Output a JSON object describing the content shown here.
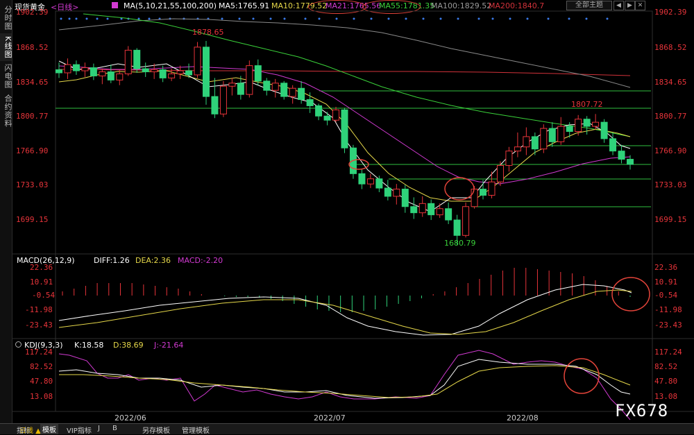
{
  "left_tabs": [
    {
      "label": "分时图",
      "active": false
    },
    {
      "label": "K线图",
      "active": true
    },
    {
      "label": "闪电图",
      "active": false
    },
    {
      "label": "合约资料",
      "active": false
    }
  ],
  "header": {
    "symbol": "现货黄金",
    "period": "<日线>",
    "ma_params": "MA(5,10,21,55,100,200)",
    "ma5": "MA5:1765.91",
    "ma10": "MA10:1779.52",
    "ma21": "MA21:1765.56",
    "ma55": "MA55:1781.35",
    "ma100": "MA100:1829.52",
    "ma200": "MA200:1840.7",
    "theme_select": "全部主题",
    "colors": {
      "ma5": "#ffffff",
      "ma10": "#e6d84a",
      "ma21": "#d23ad2",
      "ma55": "#3ad23a",
      "ma100": "#9a9a9a",
      "ma200": "#d2323a"
    }
  },
  "price_axis": {
    "ticks": [
      "1902.39",
      "1868.52",
      "1834.65",
      "1800.77",
      "1766.90",
      "1733.03",
      "1699.15"
    ]
  },
  "annotations": {
    "high1": "1878.65",
    "high2": "1807.72",
    "low": "1680.79"
  },
  "macd": {
    "title": "MACD(26,12,9)",
    "diff": "DIFF:1.26",
    "dea": "DEA:2.36",
    "macd": "MACD:-2.20",
    "ticks": [
      "22.36",
      "10.91",
      "-0.54",
      "-11.98",
      "-23.43"
    ]
  },
  "kdj": {
    "title": "KDJ(9,3,3)",
    "k": "K:18.58",
    "d": "D:38.69",
    "j": "J:-21.64",
    "ticks": [
      "117.24",
      "82.52",
      "47.80",
      "13.08"
    ]
  },
  "date_axis": [
    "2022/06",
    "2022/07",
    "2022/08"
  ],
  "watermark": "FX678",
  "bottom_tabs": [
    "日线 ▲",
    "指标",
    "模板",
    "VIP指标",
    "J",
    "B",
    "另存模板",
    "管理模板"
  ],
  "chart_data": {
    "type": "candlestick",
    "ylim": [
      1672,
      1908
    ],
    "candles": [
      [
        1851,
        1858,
        1843,
        1848
      ],
      [
        1848,
        1862,
        1842,
        1856
      ],
      [
        1856,
        1860,
        1846,
        1850
      ],
      [
        1850,
        1858,
        1844,
        1853
      ],
      [
        1853,
        1857,
        1841,
        1845
      ],
      [
        1845,
        1852,
        1837,
        1849
      ],
      [
        1849,
        1856,
        1838,
        1841
      ],
      [
        1841,
        1851,
        1836,
        1847
      ],
      [
        1847,
        1874,
        1845,
        1870
      ],
      [
        1870,
        1872,
        1848,
        1852
      ],
      [
        1852,
        1858,
        1844,
        1849
      ],
      [
        1849,
        1857,
        1842,
        1851
      ],
      [
        1851,
        1855,
        1839,
        1843
      ],
      [
        1843,
        1852,
        1840,
        1847
      ],
      [
        1847,
        1855,
        1842,
        1850
      ],
      [
        1850,
        1857,
        1843,
        1846
      ],
      [
        1846,
        1878,
        1843,
        1873
      ],
      [
        1873,
        1879,
        1817,
        1825
      ],
      [
        1825,
        1843,
        1804,
        1808
      ],
      [
        1808,
        1840,
        1805,
        1835
      ],
      [
        1835,
        1843,
        1826,
        1838
      ],
      [
        1838,
        1845,
        1822,
        1827
      ],
      [
        1827,
        1860,
        1824,
        1855
      ],
      [
        1855,
        1861,
        1836,
        1840
      ],
      [
        1840,
        1843,
        1826,
        1831
      ],
      [
        1831,
        1842,
        1824,
        1838
      ],
      [
        1838,
        1840,
        1822,
        1825
      ],
      [
        1825,
        1836,
        1818,
        1833
      ],
      [
        1833,
        1840,
        1818,
        1822
      ],
      [
        1822,
        1829,
        1809,
        1816
      ],
      [
        1816,
        1818,
        1802,
        1806
      ],
      [
        1806,
        1810,
        1797,
        1802
      ],
      [
        1802,
        1815,
        1800,
        1812
      ],
      [
        1812,
        1814,
        1770,
        1775
      ],
      [
        1775,
        1778,
        1745,
        1750
      ],
      [
        1750,
        1754,
        1735,
        1740
      ],
      [
        1740,
        1750,
        1736,
        1745
      ],
      [
        1745,
        1748,
        1732,
        1736
      ],
      [
        1736,
        1744,
        1724,
        1728
      ],
      [
        1728,
        1740,
        1720,
        1735
      ],
      [
        1735,
        1739,
        1712,
        1718
      ],
      [
        1718,
        1727,
        1706,
        1712
      ],
      [
        1712,
        1728,
        1708,
        1721
      ],
      [
        1721,
        1725,
        1705,
        1710
      ],
      [
        1710,
        1721,
        1707,
        1716
      ],
      [
        1716,
        1722,
        1701,
        1705
      ],
      [
        1705,
        1710,
        1681,
        1690
      ],
      [
        1690,
        1722,
        1688,
        1718
      ],
      [
        1718,
        1738,
        1716,
        1735
      ],
      [
        1735,
        1744,
        1725,
        1729
      ],
      [
        1729,
        1752,
        1726,
        1742
      ],
      [
        1742,
        1762,
        1738,
        1758
      ],
      [
        1758,
        1776,
        1752,
        1772
      ],
      [
        1772,
        1790,
        1766,
        1776
      ],
      [
        1776,
        1795,
        1768,
        1786
      ],
      [
        1786,
        1790,
        1768,
        1774
      ],
      [
        1774,
        1798,
        1770,
        1794
      ],
      [
        1794,
        1800,
        1776,
        1781
      ],
      [
        1781,
        1805,
        1778,
        1796
      ],
      [
        1796,
        1800,
        1785,
        1791
      ],
      [
        1791,
        1807,
        1787,
        1803
      ],
      [
        1803,
        1806,
        1788,
        1796
      ],
      [
        1796,
        1808,
        1793,
        1800
      ],
      [
        1800,
        1803,
        1780,
        1784
      ],
      [
        1784,
        1790,
        1768,
        1772
      ],
      [
        1772,
        1778,
        1760,
        1764
      ],
      [
        1764,
        1768,
        1754,
        1759
      ]
    ]
  }
}
